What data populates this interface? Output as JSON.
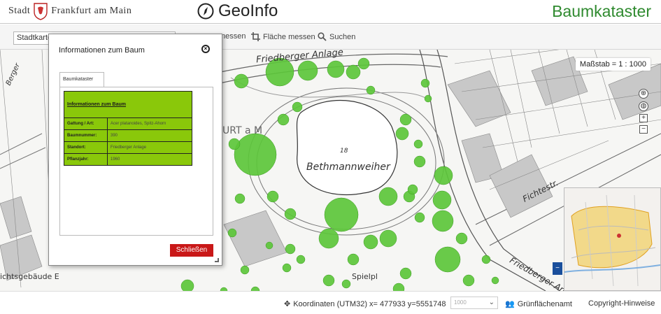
{
  "header": {
    "logo_text_1": "Stadt",
    "logo_text_2": "Frankfurt am Main",
    "product": "GeoInfo",
    "app_title": "Baumkataster"
  },
  "toolbar": {
    "map_select": "Stadtkarte",
    "measure_line_label": "messen",
    "measure_area_label": "Fläche messen",
    "search_label": "Suchen"
  },
  "map": {
    "scale_label": "Maßstab = 1 : 1000",
    "labels": {
      "street1": "Friedberger Anlage",
      "street2": "Fichtestr.",
      "street3": "Friedberger Anlage",
      "pond": "Bethmannweiher",
      "pond_number": "18",
      "playground": "Spielpl",
      "building": "ichtsgebäude E",
      "city_watermark": "URT a M",
      "street_left": "Berger"
    }
  },
  "dialog": {
    "title": "Informationen zum Baum",
    "tab": "Baumkataster",
    "table_heading": "Informationen zum Baum",
    "rows": [
      {
        "key": "Gattung / Art:",
        "value": "Acer platanoides, Spitz-Ahorn"
      },
      {
        "key": "Baumnummer:",
        "value": "390"
      },
      {
        "key": "Standort:",
        "value": "Friedberger Anlage"
      },
      {
        "key": "Pflanzjahr:",
        "value": "1960"
      }
    ],
    "close_button": "Schließen"
  },
  "footer": {
    "coordinates": "Koordinaten (UTM32) x= 477933 y=5551748",
    "scale_select_value": "1000",
    "office": "Grünflächenamt",
    "copyright": "Copyright-Hinweise"
  },
  "colors": {
    "brand_green": "#2f8a2f",
    "tree_green": "#5cc63a",
    "table_green": "#8ac80a",
    "close_red": "#c91818",
    "overview_blue": "#1a4f9c"
  }
}
